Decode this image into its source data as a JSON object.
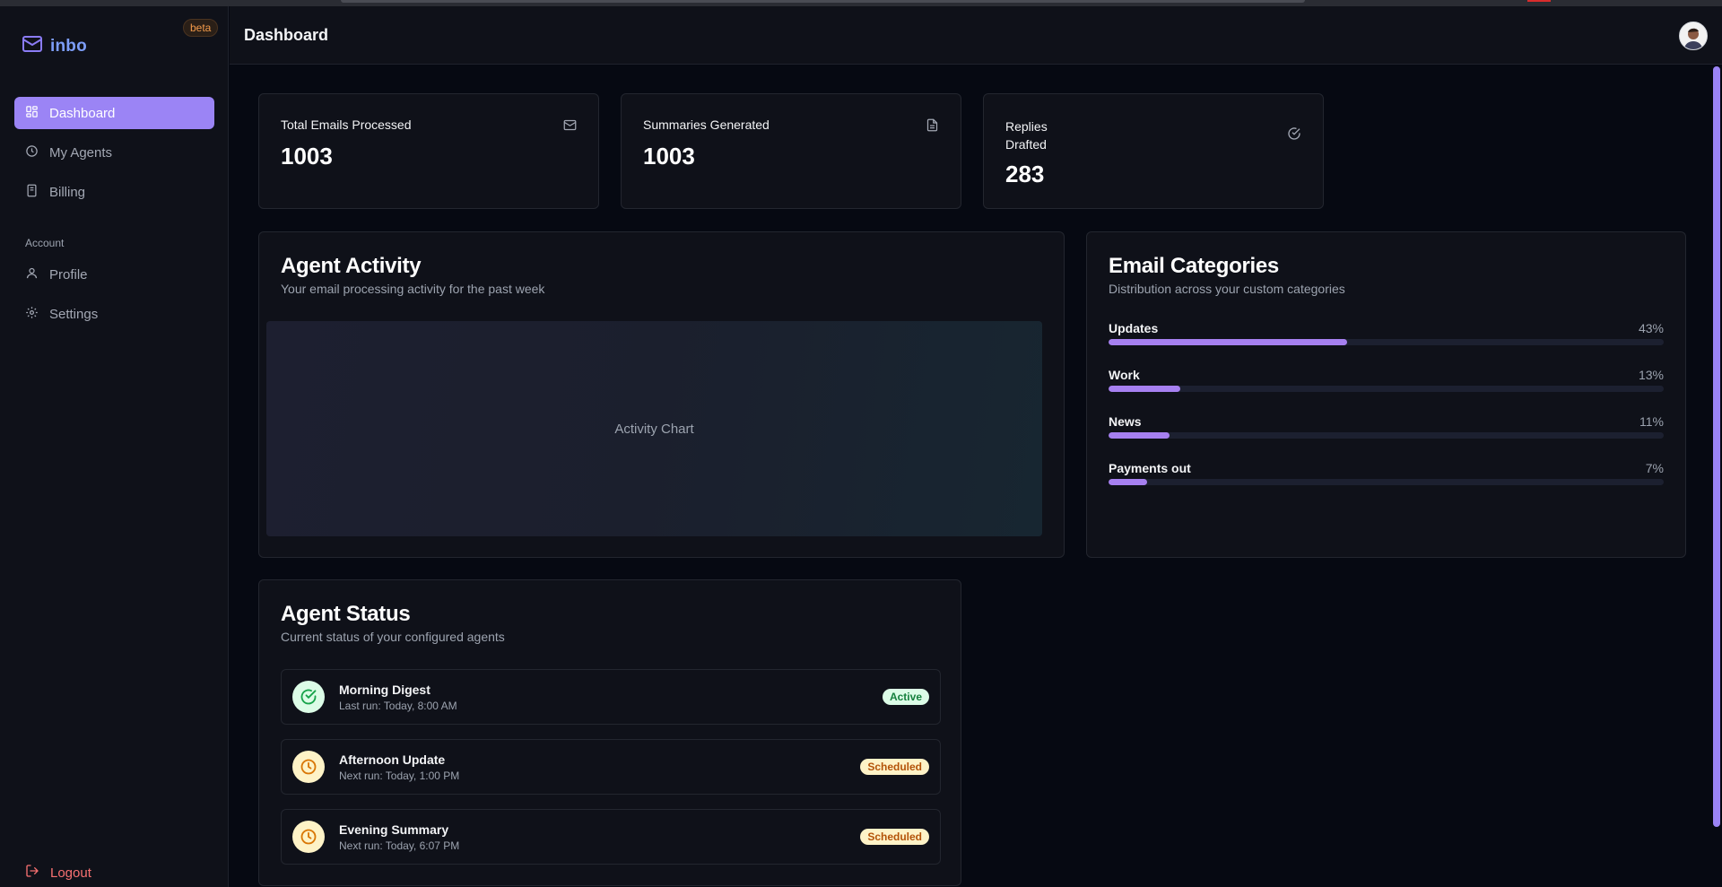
{
  "app": {
    "name": "inbo",
    "badge": "beta"
  },
  "sidebar": {
    "items": [
      {
        "label": "Dashboard",
        "icon": "dashboard-icon",
        "active": true
      },
      {
        "label": "My Agents",
        "icon": "clock-icon"
      },
      {
        "label": "Billing",
        "icon": "receipt-icon"
      }
    ],
    "account_label": "Account",
    "account_items": [
      {
        "label": "Profile",
        "icon": "user-icon"
      },
      {
        "label": "Settings",
        "icon": "gear-icon"
      }
    ],
    "logout_label": "Logout"
  },
  "header": {
    "title": "Dashboard"
  },
  "stats": [
    {
      "label": "Total Emails Processed",
      "value": "1003",
      "icon": "mail-icon"
    },
    {
      "label": "Summaries Generated",
      "value": "1003",
      "icon": "document-icon"
    },
    {
      "label_line1": "Replies",
      "label_line2": "Drafted",
      "value": "283",
      "icon": "check-circle-icon"
    }
  ],
  "activity": {
    "title": "Agent Activity",
    "subtitle": "Your email processing activity for the past week",
    "placeholder": "Activity Chart"
  },
  "categories": {
    "title": "Email Categories",
    "subtitle": "Distribution across your custom categories",
    "items": [
      {
        "name": "Updates",
        "pct_label": "43%",
        "pct": 43
      },
      {
        "name": "Work",
        "pct_label": "13%",
        "pct": 13
      },
      {
        "name": "News",
        "pct_label": "11%",
        "pct": 11
      },
      {
        "name": "Payments out",
        "pct_label": "7%",
        "pct": 7
      }
    ]
  },
  "agent_status": {
    "title": "Agent Status",
    "subtitle": "Current status of your configured agents",
    "agents": [
      {
        "name": "Morning Digest",
        "meta": "Last run: Today, 8:00 AM",
        "status": "Active",
        "icon": "check-circle-icon"
      },
      {
        "name": "Afternoon Update",
        "meta": "Next run: Today, 1:00 PM",
        "status": "Scheduled",
        "icon": "clock-icon"
      },
      {
        "name": "Evening Summary",
        "meta": "Next run: Today, 6:07 PM",
        "status": "Scheduled",
        "icon": "clock-icon"
      }
    ]
  },
  "colors": {
    "accent": "#9b84f5",
    "bar_fill": "#a680f0",
    "logout": "#f87171"
  }
}
